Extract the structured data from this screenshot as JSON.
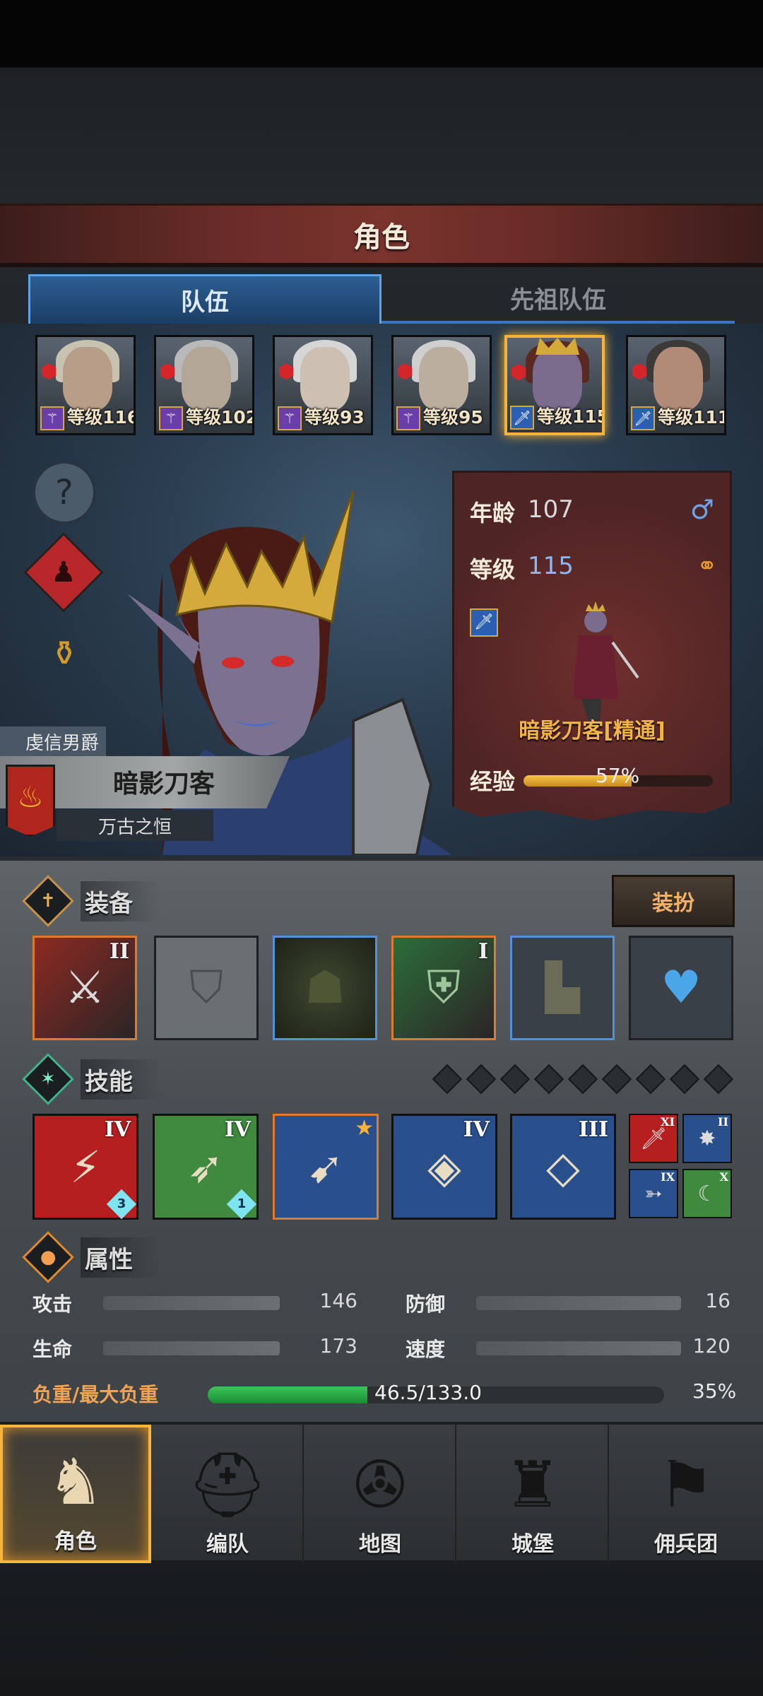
{
  "header": {
    "title": "角色"
  },
  "tabs": [
    {
      "label": "队伍",
      "active": true
    },
    {
      "label": "先祖队伍",
      "active": false
    }
  ],
  "roster": [
    {
      "level_label": "等级116",
      "class_color": "purple",
      "class_icon": "wand-icon"
    },
    {
      "level_label": "等级102",
      "class_color": "purple",
      "class_icon": "wand-icon"
    },
    {
      "level_label": "等级93",
      "class_color": "purple",
      "class_icon": "wand-icon"
    },
    {
      "level_label": "等级95",
      "class_color": "purple",
      "class_icon": "wand-icon"
    },
    {
      "level_label": "等级115",
      "class_color": "blue",
      "class_icon": "dagger-icon",
      "selected": true
    },
    {
      "level_label": "等级111",
      "class_color": "blue",
      "class_icon": "dagger-icon"
    }
  ],
  "character": {
    "title_tag": "虔信男爵",
    "name": "暗影刀客",
    "subtitle": "万古之恒",
    "age_label": "年龄",
    "age": "107",
    "level_label": "等级",
    "level": "115",
    "class_name": "暗影刀客[精通]",
    "exp_label": "经验",
    "exp_percent": "57%",
    "exp_fraction": 0.57,
    "gender_icon": "male-icon",
    "marriage_icon": "rings-icon"
  },
  "equipment": {
    "label": "装备",
    "dress_button": "装扮",
    "slots": [
      {
        "name": "weapon",
        "tier": "II",
        "rarity": "orange",
        "icon": "sword-icon"
      },
      {
        "name": "shield",
        "tier": "",
        "rarity": "empty",
        "icon": "shield-icon"
      },
      {
        "name": "hood",
        "tier": "",
        "rarity": "blue",
        "icon": "hood-icon"
      },
      {
        "name": "armor",
        "tier": "I",
        "rarity": "orange",
        "icon": "armor-icon"
      },
      {
        "name": "boots",
        "tier": "",
        "rarity": "blue",
        "icon": "boots-icon"
      },
      {
        "name": "amulet",
        "tier": "",
        "rarity": "none",
        "icon": "heart-amulet-icon"
      }
    ]
  },
  "skills": {
    "label": "技能",
    "items": [
      {
        "tier": "IV",
        "gem": "3",
        "color": "#b51f1f",
        "icon": "slash-icon"
      },
      {
        "tier": "IV",
        "gem": "1",
        "color": "#3f8a3f",
        "icon": "dash-icon"
      },
      {
        "tier": "",
        "gem": "",
        "color": "#294f8c",
        "icon": "spear-icon",
        "starred": true
      },
      {
        "tier": "IV",
        "gem": "",
        "color": "#294f8c",
        "icon": "crystal-blade-icon"
      },
      {
        "tier": "III",
        "gem": "",
        "color": "#294f8c",
        "icon": "crystal-beast-icon"
      }
    ],
    "mini": [
      {
        "tier": "XI",
        "color": "#b51f1f",
        "icon": "dagger-icon"
      },
      {
        "tier": "II",
        "color": "#294f8c",
        "icon": "burst-icon"
      },
      {
        "tier": "IX",
        "color": "#294f8c",
        "icon": "beast-icon"
      },
      {
        "tier": "X",
        "color": "#3f8a3f",
        "icon": "claw-icon"
      }
    ]
  },
  "attributes": {
    "label": "属性",
    "attack_label": "攻击",
    "attack": "146",
    "defense_label": "防御",
    "defense": "16",
    "hp_label": "生命",
    "hp": "173",
    "speed_label": "速度",
    "speed": "120",
    "load_label": "负重/最大负重",
    "load_value": "46.5/133.0",
    "load_percent": "35%",
    "load_fraction": 0.35
  },
  "nav": [
    {
      "label": "角色",
      "icon": "knight-icon",
      "active": true
    },
    {
      "label": "编队",
      "icon": "helmet-icon"
    },
    {
      "label": "地图",
      "icon": "compass-icon"
    },
    {
      "label": "城堡",
      "icon": "castle-icon"
    },
    {
      "label": "佣兵团",
      "icon": "mercenary-icon"
    }
  ]
}
